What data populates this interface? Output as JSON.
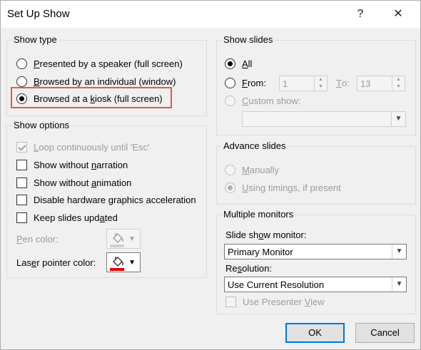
{
  "window": {
    "title": "Set Up Show",
    "help_label": "?",
    "close_label": "✕"
  },
  "show_type": {
    "legend": "Show type",
    "options": [
      {
        "pre": "",
        "acc": "P",
        "post": "resented by a speaker (full screen)"
      },
      {
        "pre": "",
        "acc": "B",
        "post": "rowsed by an individual (window)"
      },
      {
        "pre": "Browsed at a ",
        "acc": "k",
        "post": "iosk (full screen)"
      }
    ],
    "selected_index": 2
  },
  "show_options": {
    "legend": "Show options",
    "items": [
      {
        "pre": "",
        "acc": "L",
        "post": "oop continuously until 'Esc'"
      },
      {
        "pre": "Show without ",
        "acc": "n",
        "post": "arration"
      },
      {
        "pre": "Show without ",
        "acc": "a",
        "post": "nimation"
      },
      {
        "pre": "Disable hardware ",
        "acc": "g",
        "post": "raphics acceleration"
      },
      {
        "pre": "Keep slides upd",
        "acc": "a",
        "post": "ted"
      }
    ],
    "pen_color": {
      "pre": "",
      "acc": "P",
      "post": "en color:",
      "color": "#a0a0a0"
    },
    "laser_color": {
      "pre": "Las",
      "acc": "e",
      "post": "r pointer color:",
      "color": "#e00000"
    }
  },
  "show_slides": {
    "legend": "Show slides",
    "all": {
      "pre": "",
      "acc": "A",
      "post": "ll"
    },
    "from": {
      "pre": "",
      "acc": "F",
      "post": "rom:",
      "value": "1"
    },
    "to": {
      "pre": "",
      "acc": "T",
      "post": "o:",
      "value": "13"
    },
    "custom": {
      "pre": "",
      "acc": "C",
      "post": "ustom show:"
    },
    "custom_value": ""
  },
  "advance_slides": {
    "legend": "Advance slides",
    "manually": {
      "pre": "",
      "acc": "M",
      "post": "anually"
    },
    "timings": {
      "pre": "",
      "acc": "U",
      "post": "sing timings, if present"
    }
  },
  "multiple_monitors": {
    "legend": "Multiple monitors",
    "monitor_label": {
      "pre": "Slide sh",
      "acc": "o",
      "post": "w monitor:"
    },
    "monitor_value": "Primary Monitor",
    "resolution_label": {
      "pre": "Re",
      "acc": "s",
      "post": "olution:"
    },
    "resolution_value": "Use Current Resolution",
    "presenter": {
      "pre": "Use Presenter ",
      "acc": "V",
      "post": "iew"
    }
  },
  "buttons": {
    "ok": "OK",
    "cancel": "Cancel"
  }
}
